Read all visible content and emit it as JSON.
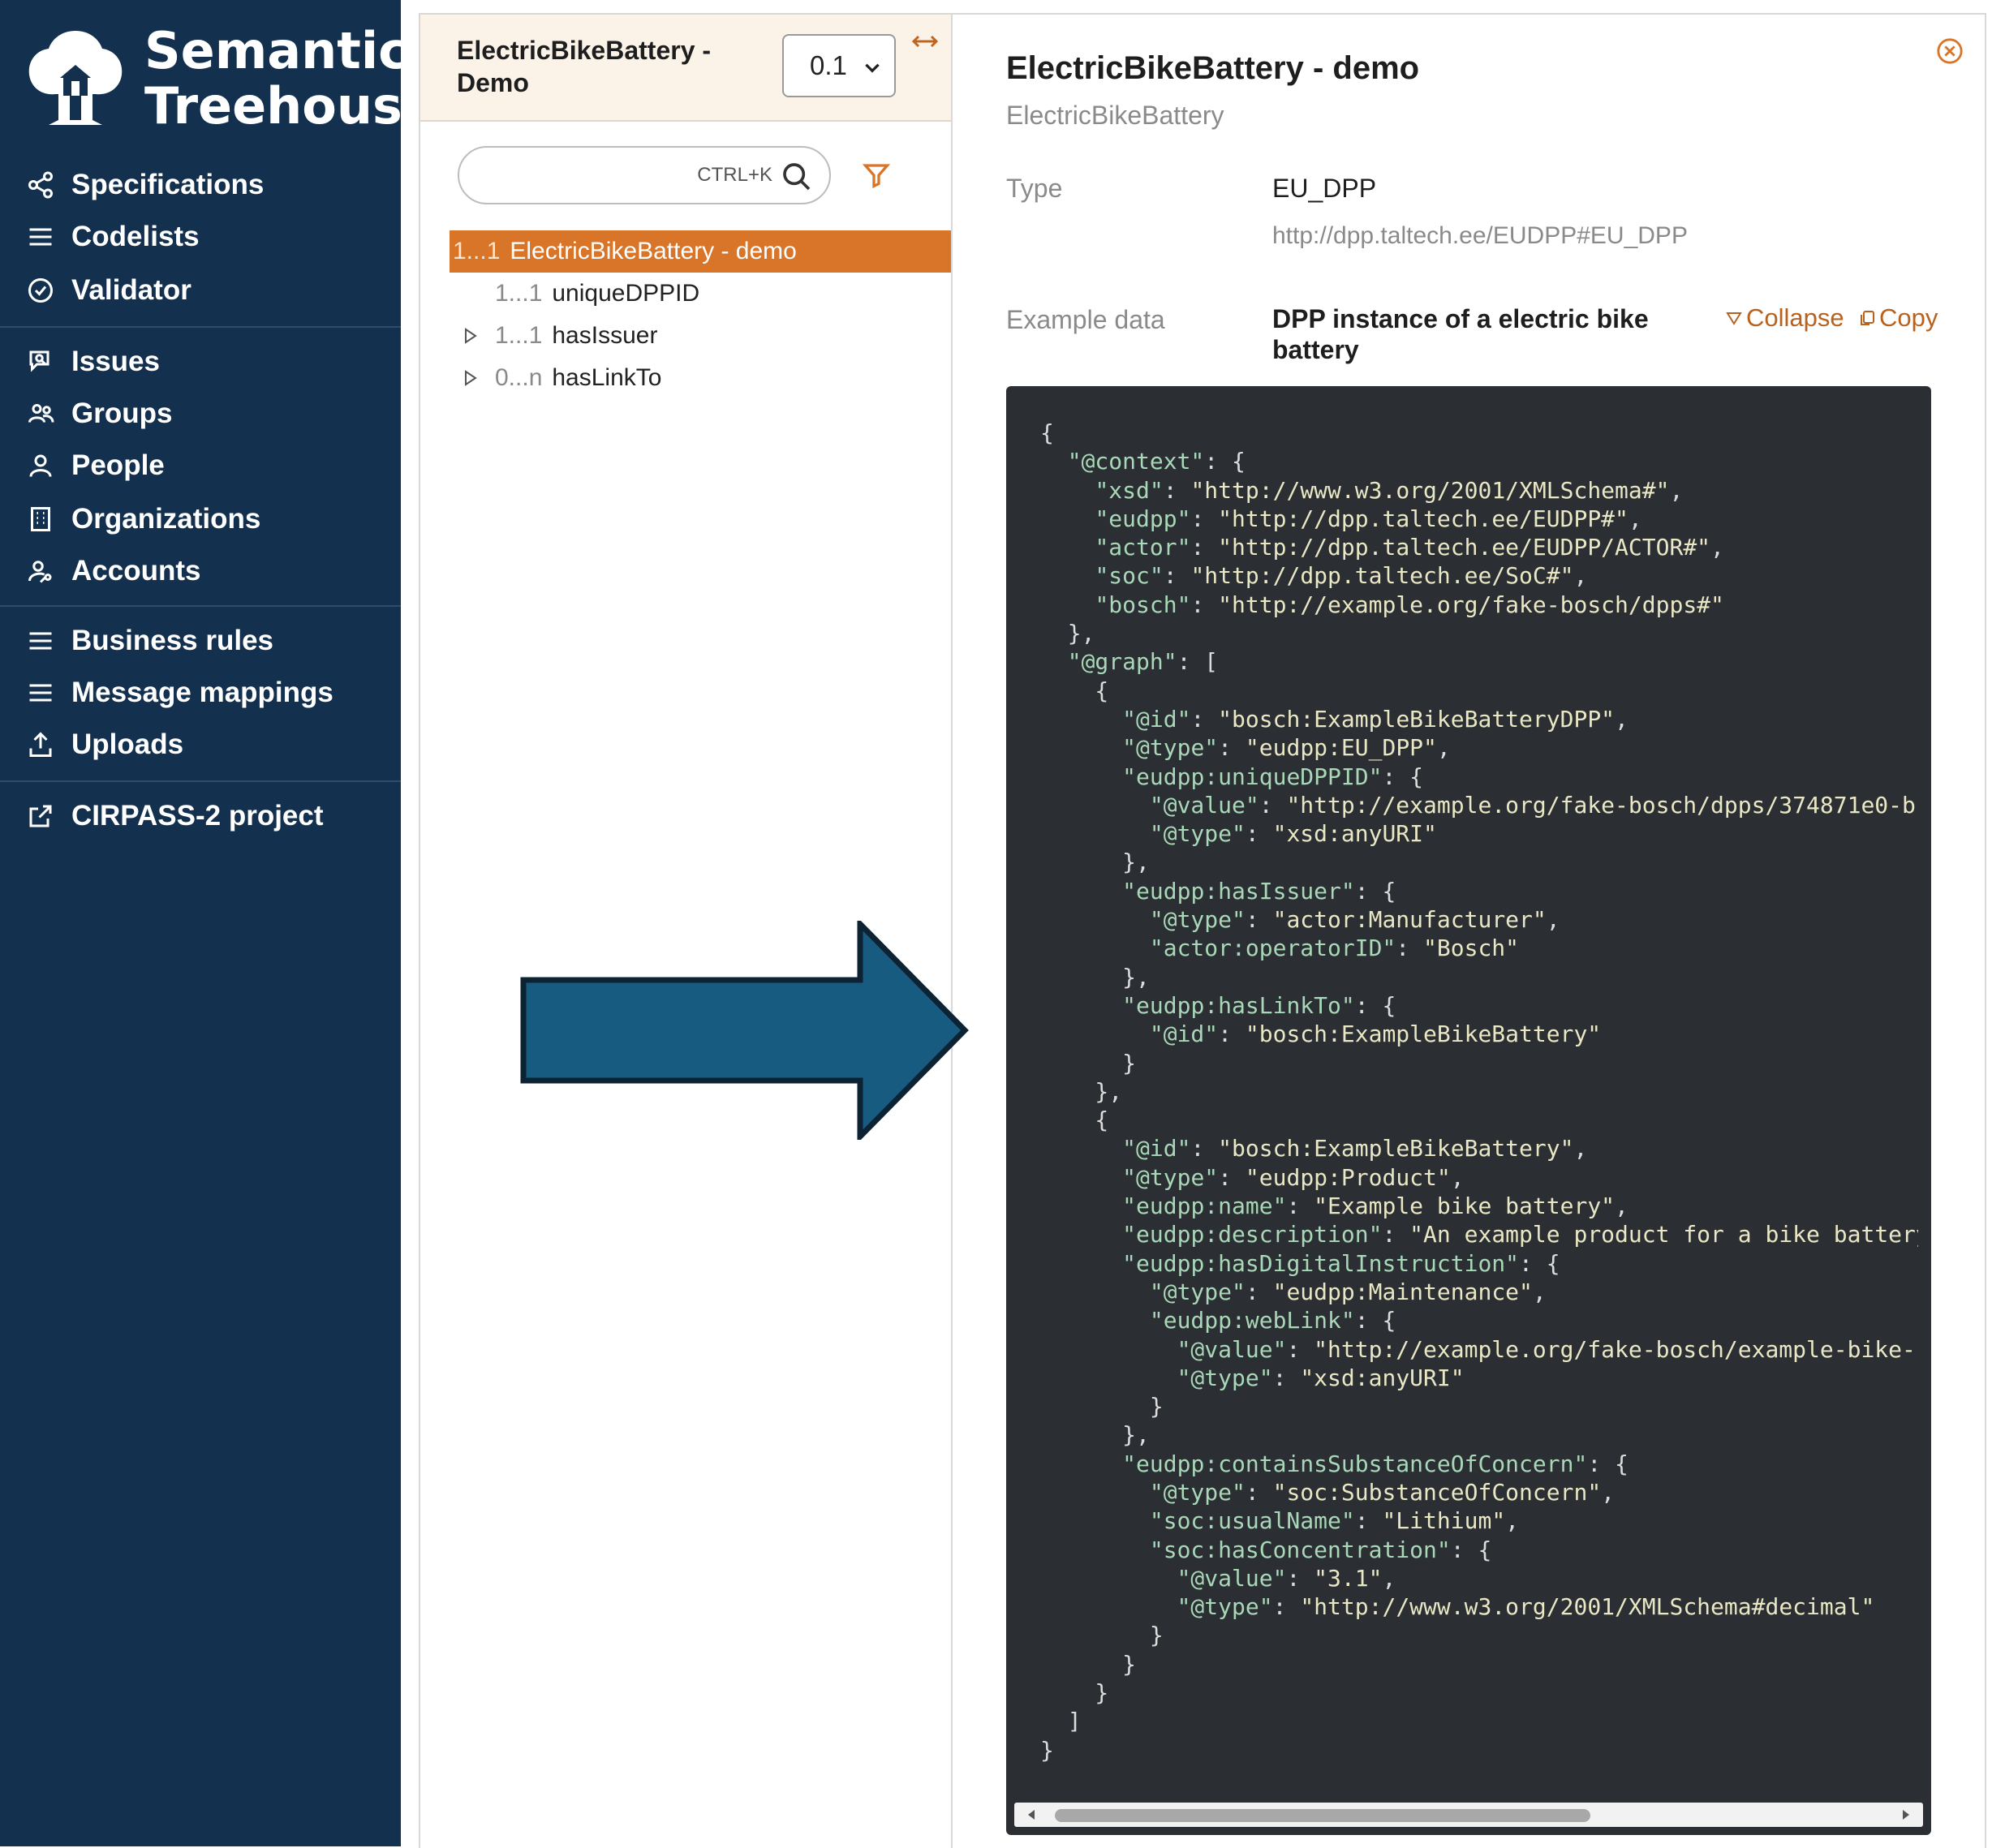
{
  "brand": {
    "line1": "Semantic",
    "line2": "Treehouse"
  },
  "sidebar": {
    "groups": [
      [
        {
          "label": "Specifications",
          "icon": "share-nodes-icon"
        },
        {
          "label": "Codelists",
          "icon": "list-icon"
        },
        {
          "label": "Validator",
          "icon": "check-circle-icon"
        }
      ],
      [
        {
          "label": "Issues",
          "icon": "chat-search-icon"
        },
        {
          "label": "Groups",
          "icon": "users-icon"
        },
        {
          "label": "People",
          "icon": "person-icon"
        },
        {
          "label": "Organizations",
          "icon": "building-icon"
        },
        {
          "label": "Accounts",
          "icon": "user-key-icon"
        }
      ],
      [
        {
          "label": "Business rules",
          "icon": "list-icon"
        },
        {
          "label": "Message mappings",
          "icon": "list-icon"
        },
        {
          "label": "Uploads",
          "icon": "upload-icon"
        }
      ],
      [
        {
          "label": "CIRPASS-2 project",
          "icon": "external-link-icon"
        }
      ]
    ]
  },
  "tree": {
    "spec_title": "ElectricBikeBattery - Demo",
    "version": "0.1",
    "search_placeholder": "",
    "search_hint": "CTRL+K",
    "rows": [
      {
        "card": "1...1",
        "label": "ElectricBikeBattery - demo",
        "selected": true
      },
      {
        "card": "1...1",
        "label": "uniqueDPPID"
      },
      {
        "card": "1...1",
        "label": "hasIssuer"
      },
      {
        "card": "0...n",
        "label": "hasLinkTo"
      }
    ]
  },
  "detail": {
    "title": "ElectricBikeBattery - demo",
    "subtitle": "ElectricBikeBattery",
    "type_label": "Type",
    "type_value": "EU_DPP",
    "type_uri": "http://dpp.taltech.ee/EUDPP#EU_DPP",
    "example_label": "Example data",
    "example_title": "DPP instance of a electric bike battery",
    "collapse_label": "Collapse",
    "copy_label": "Copy",
    "code_lines": [
      "{",
      "  \"@context\": {",
      "    \"xsd\": \"http://www.w3.org/2001/XMLSchema#\",",
      "    \"eudpp\": \"http://dpp.taltech.ee/EUDPP#\",",
      "    \"actor\": \"http://dpp.taltech.ee/EUDPP/ACTOR#\",",
      "    \"soc\": \"http://dpp.taltech.ee/SoC#\",",
      "    \"bosch\": \"http://example.org/fake-bosch/dpps#\"",
      "  },",
      "  \"@graph\": [",
      "    {",
      "      \"@id\": \"bosch:ExampleBikeBatteryDPP\",",
      "      \"@type\": \"eudpp:EU_DPP\",",
      "      \"eudpp:uniqueDPPID\": {",
      "        \"@value\": \"http://example.org/fake-bosch/dpps/374871e0-b",
      "        \"@type\": \"xsd:anyURI\"",
      "      },",
      "      \"eudpp:hasIssuer\": {",
      "        \"@type\": \"actor:Manufacturer\",",
      "        \"actor:operatorID\": \"Bosch\"",
      "      },",
      "      \"eudpp:hasLinkTo\": {",
      "        \"@id\": \"bosch:ExampleBikeBattery\"",
      "      }",
      "    },",
      "    {",
      "      \"@id\": \"bosch:ExampleBikeBattery\",",
      "      \"@type\": \"eudpp:Product\",",
      "      \"eudpp:name\": \"Example bike battery\",",
      "      \"eudpp:description\": \"An example product for a bike battery",
      "      \"eudpp:hasDigitalInstruction\": {",
      "        \"@type\": \"eudpp:Maintenance\",",
      "        \"eudpp:webLink\": {",
      "          \"@value\": \"http://example.org/fake-bosch/example-bike-",
      "          \"@type\": \"xsd:anyURI\"",
      "        }",
      "      },",
      "      \"eudpp:containsSubstanceOfConcern\": {",
      "        \"@type\": \"soc:SubstanceOfConcern\",",
      "        \"soc:usualName\": \"Lithium\",",
      "        \"soc:hasConcentration\": {",
      "          \"@value\": \"3.1\",",
      "          \"@type\": \"http://www.w3.org/2001/XMLSchema#decimal\"",
      "        }",
      "      }",
      "    }",
      "  ]",
      "}"
    ],
    "scroll_position": 0.0
  },
  "colors": {
    "sidebar_bg": "#14304f",
    "accent": "#d97529",
    "link": "#b8621e",
    "code_bg": "#2b2e33",
    "arrow_fill": "#175c80",
    "arrow_stroke": "#0d2233"
  }
}
